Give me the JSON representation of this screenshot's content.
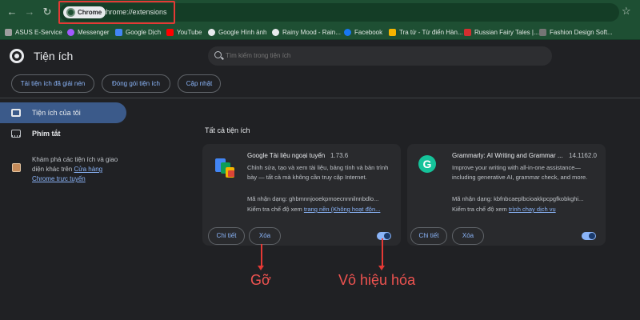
{
  "browser": {
    "chip_label": "Chrome",
    "url": "chrome://extensions"
  },
  "bookmarks": [
    {
      "label": "ASUS E-Service",
      "color": "#9e9e9e"
    },
    {
      "label": "Messenger",
      "color": "#a259ff"
    },
    {
      "label": "Google Dịch",
      "color": "#4285f4"
    },
    {
      "label": "YouTube",
      "color": "#ff0000"
    },
    {
      "label": "Google Hình ảnh",
      "color": "#e8eaed"
    },
    {
      "label": "Rainy Mood - Rain...",
      "color": "#e8eaed"
    },
    {
      "label": "Facebook",
      "color": "#1877f2"
    },
    {
      "label": "Tra từ - Từ điển Hàn...",
      "color": "#f4b400"
    },
    {
      "label": "Russian Fairy Tales |...",
      "color": "#d32f2f"
    },
    {
      "label": "Fashion Design Soft...",
      "color": "#757575"
    }
  ],
  "header": {
    "title": "Tiện ích",
    "search_placeholder": "Tìm kiếm trong tiện ích"
  },
  "toolbar": {
    "load_unpacked": "Tải tiện ích đã giải nén",
    "pack": "Đóng gói tiện ích",
    "update": "Cập nhật"
  },
  "sidebar": {
    "my_extensions": "Tiện ích của tôi",
    "shortcuts": "Phím tắt",
    "promo_text": "Khám phá các tiện ích và giao diện khác trên ",
    "promo_link": "Cửa hàng Chrome trực tuyến"
  },
  "main": {
    "section_title": "Tất cả tiện ích",
    "cards": [
      {
        "name": "Google Tài liệu ngoại tuyến",
        "version": "1.73.6",
        "description": "Chỉnh sửa, tạo và xem tài liệu, bảng tính và bản trình bày — tất cả mà không cần truy cập Internet.",
        "id_label": "Mã nhận dạng: ghbmnnjooekpmoecnnnilnnbdlo...",
        "inspect_label": "Kiểm tra chế độ xem ",
        "inspect_link": "trang nền (Không hoạt độn...",
        "details": "Chi tiết",
        "remove": "Xóa",
        "enabled": true,
        "icon": "google-docs-offline-icon"
      },
      {
        "name": "Grammarly: AI Writing and Grammar ...",
        "version": "14.1162.0",
        "description": "Improve your writing with all-in-one assistance—including generative AI, grammar check, and more.",
        "id_label": "Mã nhận dạng: kbfnbcaeplbcioakkpcpgfkobkghi...",
        "inspect_label": "Kiểm tra chế độ xem ",
        "inspect_link": "trình chạy dịch vụ",
        "details": "Chi tiết",
        "remove": "Xóa",
        "enabled": true,
        "icon": "grammarly-icon"
      }
    ]
  },
  "annotations": {
    "remove_note": "Gỡ",
    "disable_note": "Vô hiệu hóa",
    "color": "#e53935"
  }
}
